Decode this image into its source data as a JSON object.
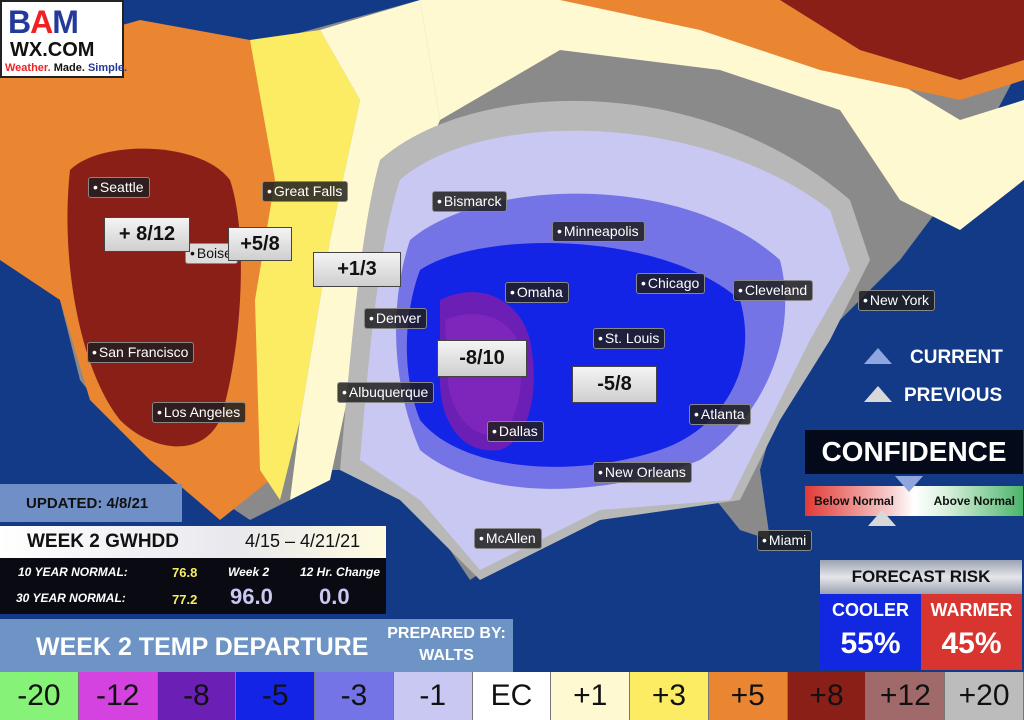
{
  "logo": {
    "brand": "BAM",
    "domain": "WX.COM",
    "tagline": [
      "Weather.",
      "Made.",
      "Simple."
    ]
  },
  "cities": [
    "Seattle",
    "Great Falls",
    "Bismarck",
    "Minneapolis",
    "Boise",
    "Chicago",
    "Omaha",
    "Cleveland",
    "New York",
    "Denver",
    "St. Louis",
    "San Francisco",
    "Albuquerque",
    "Los Angeles",
    "Atlanta",
    "Dallas",
    "New Orleans",
    "McAllen",
    "Miami"
  ],
  "departures": [
    "+ 8/12",
    "+5/8",
    "+1/3",
    "-8/10",
    "-5/8"
  ],
  "markers": {
    "current_label": "CURRENT",
    "previous_label": "PREVIOUS",
    "current_color": "#8fa6e0",
    "previous_color": "#d8d8d8"
  },
  "confidence": {
    "title": "CONFIDENCE",
    "low_label": "Below Normal",
    "high_label": "Above Normal",
    "current_position": 0.48,
    "previous_position": 0.35
  },
  "forecast_risk": {
    "title": "FORECAST RISK",
    "cooler_label": "COOLER",
    "cooler_value": "55%",
    "warmer_label": "WARMER",
    "warmer_value": "45%",
    "cooler_color": "#1228e0",
    "warmer_color": "#d83530"
  },
  "info": {
    "updated": "UPDATED: 4/8/21",
    "gwhdd_title": "WEEK 2 GWHDD",
    "dates": "4/15 – 4/21/21",
    "ten_year_label": "10 YEAR NORMAL:",
    "ten_year_value": "76.8",
    "thirty_year_label": "30 YEAR NORMAL:",
    "thirty_year_value": "77.2",
    "week2_label": "Week 2",
    "week2_value": "96.0",
    "change_label": "12 Hr. Change",
    "change_value": "0.0"
  },
  "footer": {
    "title": "WEEK 2 TEMP DEPARTURE",
    "prepared_label": "PREPARED BY:",
    "prepared_name": "WALTS"
  },
  "legend": [
    {
      "label": "-20",
      "color": "#86f277"
    },
    {
      "label": "-12",
      "color": "#d442e0"
    },
    {
      "label": "-8",
      "color": "#6c1fb4"
    },
    {
      "label": "-5",
      "color": "#1424e6"
    },
    {
      "label": "-3",
      "color": "#7474e6"
    },
    {
      "label": "-1",
      "color": "#c8c8f2"
    },
    {
      "label": "EC",
      "color": "#ffffff"
    },
    {
      "label": "+1",
      "color": "#fff9d2"
    },
    {
      "label": "+3",
      "color": "#fbec64"
    },
    {
      "label": "+5",
      "color": "#ea8532"
    },
    {
      "label": "+8",
      "color": "#8a1f17"
    },
    {
      "label": "+12",
      "color": "#a06a6a"
    },
    {
      "label": "+20",
      "color": "#bcbcbc"
    }
  ]
}
